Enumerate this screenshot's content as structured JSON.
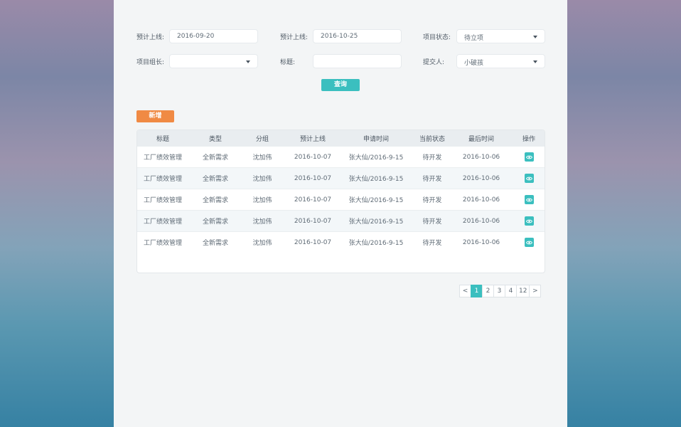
{
  "filters": {
    "expected_launch_from": {
      "label": "预计上线:",
      "value": "2016-09-20"
    },
    "expected_launch_to": {
      "label": "预计上线:",
      "value": "2016-10-25"
    },
    "project_status": {
      "label": "项目状态:",
      "value": "待立项"
    },
    "team_leader": {
      "label": "项目组长:",
      "value": ""
    },
    "title": {
      "label": "标题:",
      "value": ""
    },
    "submitter": {
      "label": "提交人:",
      "value": "小破孩"
    }
  },
  "buttons": {
    "query": "查询",
    "add": "新增"
  },
  "table": {
    "headers": [
      "标题",
      "类型",
      "分组",
      "预计上线",
      "申请时间",
      "当前状态",
      "最后时间",
      "操作"
    ],
    "rows": [
      [
        "工厂绩效管理",
        "全新需求",
        "沈加伟",
        "2016-10-07",
        "张大仙/2016-9-15",
        "待开发",
        "2016-10-06"
      ],
      [
        "工厂绩效管理",
        "全新需求",
        "沈加伟",
        "2016-10-07",
        "张大仙/2016-9-15",
        "待开发",
        "2016-10-06"
      ],
      [
        "工厂绩效管理",
        "全新需求",
        "沈加伟",
        "2016-10-07",
        "张大仙/2016-9-15",
        "待开发",
        "2016-10-06"
      ],
      [
        "工厂绩效管理",
        "全新需求",
        "沈加伟",
        "2016-10-07",
        "张大仙/2016-9-15",
        "待开发",
        "2016-10-06"
      ],
      [
        "工厂绩效管理",
        "全新需求",
        "沈加伟",
        "2016-10-07",
        "张大仙/2016-9-15",
        "待开发",
        "2016-10-06"
      ]
    ],
    "action_icon": "eye-icon"
  },
  "pagination": {
    "prev": "<",
    "pages": [
      "1",
      "2",
      "3",
      "4",
      "12"
    ],
    "current": "1",
    "next": ">"
  },
  "colors": {
    "accent": "#3bbfbf",
    "add_button": "#f08a44",
    "panel": "#f3f5f6"
  }
}
